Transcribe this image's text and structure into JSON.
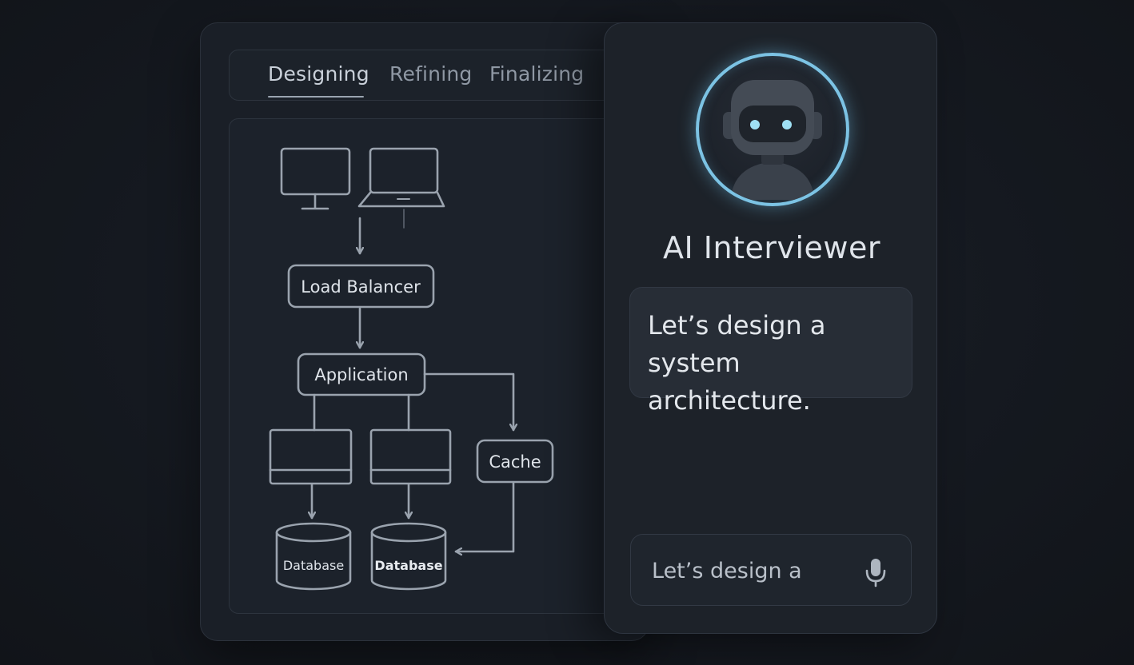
{
  "tabs": [
    {
      "label": "Designing",
      "active": true
    },
    {
      "label": "Refining",
      "active": false
    },
    {
      "label": "Finalizing",
      "active": false
    }
  ],
  "diagram": {
    "nodes": {
      "load_balancer": "Load Balancer",
      "application": "Application",
      "cache": "Cache",
      "database_1": "Database",
      "database_2": "Database"
    },
    "icons": [
      "desktop-monitor-icon",
      "laptop-icon",
      "server-icon",
      "database-icon"
    ]
  },
  "interviewer": {
    "title": "AI Interviewer",
    "message": "Let’s design a system architecture.",
    "avatar_icon": "robot-icon"
  },
  "input": {
    "value": "Let’s design a",
    "mic_icon": "microphone-icon"
  },
  "colors": {
    "background": "#151920",
    "panel": "#1d2229",
    "accent_ring": "#7cc3e4",
    "diagram_stroke": "#9aa3ae",
    "text_primary": "#dfe4ea"
  }
}
